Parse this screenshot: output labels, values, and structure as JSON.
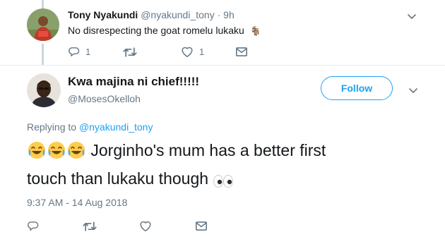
{
  "reply_tweet": {
    "author_name": "Tony Nyakundi",
    "author_handle": "@nyakundi_tony",
    "separator": "·",
    "time": "9h",
    "text": "No disrespecting the goat romelu lukaku",
    "emoji": "🐐",
    "reply_count": "1",
    "like_count": "1"
  },
  "main_tweet": {
    "author_name": "Kwa majina ni chief!!!!!",
    "author_handle": "@MosesOkelloh",
    "follow_label": "Follow",
    "replying_prefix": "Replying to",
    "replying_to": "@nyakundi_tony",
    "emoji_lead": "😂😂😂",
    "text_line1": "Jorginho's mum has a better first",
    "text_line2": "touch than lukaku though",
    "emoji_trail": "👀",
    "timestamp": "9:37 AM - 14 Aug 2018"
  },
  "colors": {
    "accent": "#1da1f2",
    "muted": "#657786",
    "text": "#14171a",
    "divider": "#e6ecf0"
  },
  "icons": [
    "reply-icon",
    "retweet-icon",
    "like-icon",
    "direct-message-icon",
    "chevron-down-icon",
    "laughing-emoji",
    "eyes-emoji",
    "goat-emoji"
  ]
}
